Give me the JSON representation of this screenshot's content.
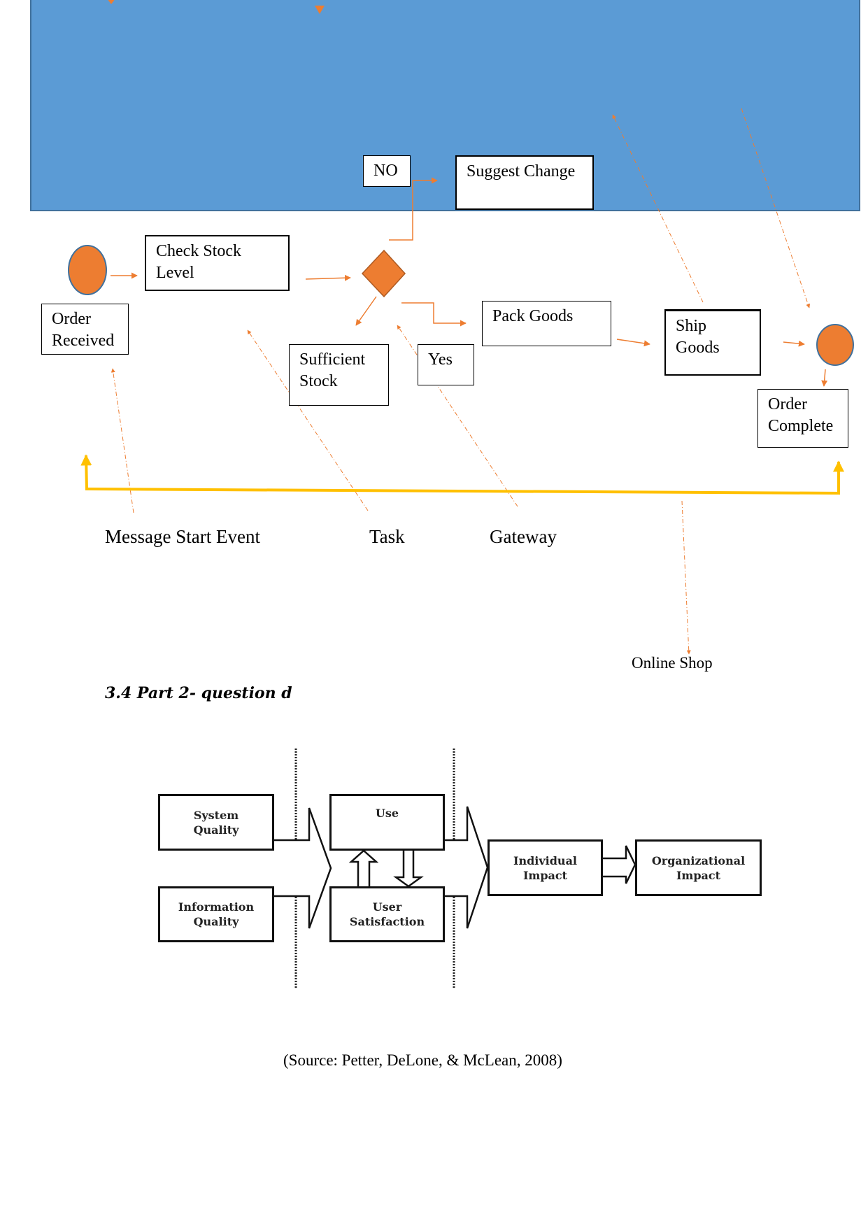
{
  "bpmn": {
    "pool_label": "",
    "colors": {
      "pool": "#5B9BD5",
      "event": "#ED7D31",
      "gateway": "#ED7D31",
      "connector": "#ED7D31",
      "bracket": "#FFC000"
    },
    "boxes": {
      "no": "NO",
      "suggest_change": "Suggest Change",
      "check_stock": [
        "Check Stock",
        "Level"
      ],
      "order_received": [
        "Order",
        "Received"
      ],
      "sufficient_stock": [
        "Sufficient",
        "Stock"
      ],
      "yes": "Yes",
      "pack_goods": "Pack Goods",
      "ship_goods": [
        "Ship",
        "Goods"
      ],
      "order_complete": [
        "Order",
        "Complete"
      ]
    },
    "legend": {
      "message_start_event": "Message Start Event",
      "task": "Task",
      "gateway": "Gateway",
      "online_shop": "Online Shop"
    }
  },
  "section_heading": "3.4 Part 2- question d",
  "model_diagram": {
    "system_quality": [
      "System",
      "Quality"
    ],
    "information_quality": [
      "Information",
      "Quality"
    ],
    "use": "Use",
    "user_satisfaction": [
      "User",
      "Satisfaction"
    ],
    "individual_impact": [
      "Individual",
      "Impact"
    ],
    "organizational_impact": [
      "Organizational",
      "Impact"
    ]
  },
  "caption": "(Source: Petter, DeLone, & McLean, 2008)"
}
